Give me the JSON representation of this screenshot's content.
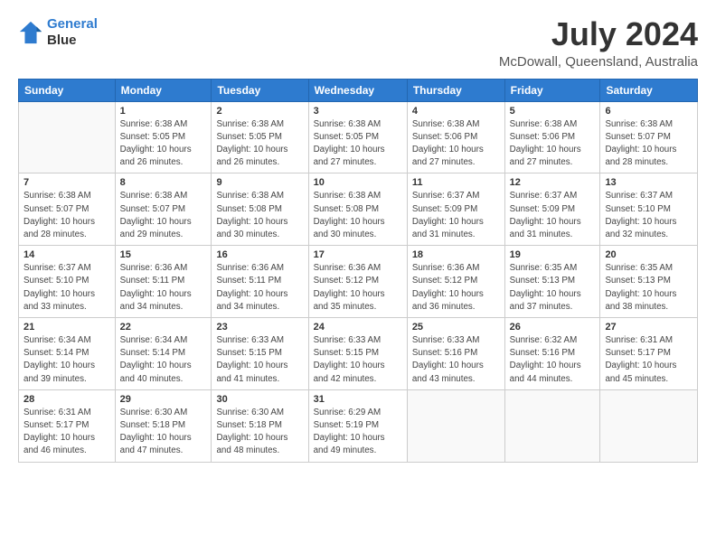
{
  "header": {
    "logo_line1": "General",
    "logo_line2": "Blue",
    "title": "July 2024",
    "subtitle": "McDowall, Queensland, Australia"
  },
  "weekdays": [
    "Sunday",
    "Monday",
    "Tuesday",
    "Wednesday",
    "Thursday",
    "Friday",
    "Saturday"
  ],
  "weeks": [
    [
      {
        "day": "",
        "info": ""
      },
      {
        "day": "1",
        "info": "Sunrise: 6:38 AM\nSunset: 5:05 PM\nDaylight: 10 hours\nand 26 minutes."
      },
      {
        "day": "2",
        "info": "Sunrise: 6:38 AM\nSunset: 5:05 PM\nDaylight: 10 hours\nand 26 minutes."
      },
      {
        "day": "3",
        "info": "Sunrise: 6:38 AM\nSunset: 5:05 PM\nDaylight: 10 hours\nand 27 minutes."
      },
      {
        "day": "4",
        "info": "Sunrise: 6:38 AM\nSunset: 5:06 PM\nDaylight: 10 hours\nand 27 minutes."
      },
      {
        "day": "5",
        "info": "Sunrise: 6:38 AM\nSunset: 5:06 PM\nDaylight: 10 hours\nand 27 minutes."
      },
      {
        "day": "6",
        "info": "Sunrise: 6:38 AM\nSunset: 5:07 PM\nDaylight: 10 hours\nand 28 minutes."
      }
    ],
    [
      {
        "day": "7",
        "info": "Sunrise: 6:38 AM\nSunset: 5:07 PM\nDaylight: 10 hours\nand 28 minutes."
      },
      {
        "day": "8",
        "info": "Sunrise: 6:38 AM\nSunset: 5:07 PM\nDaylight: 10 hours\nand 29 minutes."
      },
      {
        "day": "9",
        "info": "Sunrise: 6:38 AM\nSunset: 5:08 PM\nDaylight: 10 hours\nand 30 minutes."
      },
      {
        "day": "10",
        "info": "Sunrise: 6:38 AM\nSunset: 5:08 PM\nDaylight: 10 hours\nand 30 minutes."
      },
      {
        "day": "11",
        "info": "Sunrise: 6:37 AM\nSunset: 5:09 PM\nDaylight: 10 hours\nand 31 minutes."
      },
      {
        "day": "12",
        "info": "Sunrise: 6:37 AM\nSunset: 5:09 PM\nDaylight: 10 hours\nand 31 minutes."
      },
      {
        "day": "13",
        "info": "Sunrise: 6:37 AM\nSunset: 5:10 PM\nDaylight: 10 hours\nand 32 minutes."
      }
    ],
    [
      {
        "day": "14",
        "info": "Sunrise: 6:37 AM\nSunset: 5:10 PM\nDaylight: 10 hours\nand 33 minutes."
      },
      {
        "day": "15",
        "info": "Sunrise: 6:36 AM\nSunset: 5:11 PM\nDaylight: 10 hours\nand 34 minutes."
      },
      {
        "day": "16",
        "info": "Sunrise: 6:36 AM\nSunset: 5:11 PM\nDaylight: 10 hours\nand 34 minutes."
      },
      {
        "day": "17",
        "info": "Sunrise: 6:36 AM\nSunset: 5:12 PM\nDaylight: 10 hours\nand 35 minutes."
      },
      {
        "day": "18",
        "info": "Sunrise: 6:36 AM\nSunset: 5:12 PM\nDaylight: 10 hours\nand 36 minutes."
      },
      {
        "day": "19",
        "info": "Sunrise: 6:35 AM\nSunset: 5:13 PM\nDaylight: 10 hours\nand 37 minutes."
      },
      {
        "day": "20",
        "info": "Sunrise: 6:35 AM\nSunset: 5:13 PM\nDaylight: 10 hours\nand 38 minutes."
      }
    ],
    [
      {
        "day": "21",
        "info": "Sunrise: 6:34 AM\nSunset: 5:14 PM\nDaylight: 10 hours\nand 39 minutes."
      },
      {
        "day": "22",
        "info": "Sunrise: 6:34 AM\nSunset: 5:14 PM\nDaylight: 10 hours\nand 40 minutes."
      },
      {
        "day": "23",
        "info": "Sunrise: 6:33 AM\nSunset: 5:15 PM\nDaylight: 10 hours\nand 41 minutes."
      },
      {
        "day": "24",
        "info": "Sunrise: 6:33 AM\nSunset: 5:15 PM\nDaylight: 10 hours\nand 42 minutes."
      },
      {
        "day": "25",
        "info": "Sunrise: 6:33 AM\nSunset: 5:16 PM\nDaylight: 10 hours\nand 43 minutes."
      },
      {
        "day": "26",
        "info": "Sunrise: 6:32 AM\nSunset: 5:16 PM\nDaylight: 10 hours\nand 44 minutes."
      },
      {
        "day": "27",
        "info": "Sunrise: 6:31 AM\nSunset: 5:17 PM\nDaylight: 10 hours\nand 45 minutes."
      }
    ],
    [
      {
        "day": "28",
        "info": "Sunrise: 6:31 AM\nSunset: 5:17 PM\nDaylight: 10 hours\nand 46 minutes."
      },
      {
        "day": "29",
        "info": "Sunrise: 6:30 AM\nSunset: 5:18 PM\nDaylight: 10 hours\nand 47 minutes."
      },
      {
        "day": "30",
        "info": "Sunrise: 6:30 AM\nSunset: 5:18 PM\nDaylight: 10 hours\nand 48 minutes."
      },
      {
        "day": "31",
        "info": "Sunrise: 6:29 AM\nSunset: 5:19 PM\nDaylight: 10 hours\nand 49 minutes."
      },
      {
        "day": "",
        "info": ""
      },
      {
        "day": "",
        "info": ""
      },
      {
        "day": "",
        "info": ""
      }
    ]
  ]
}
